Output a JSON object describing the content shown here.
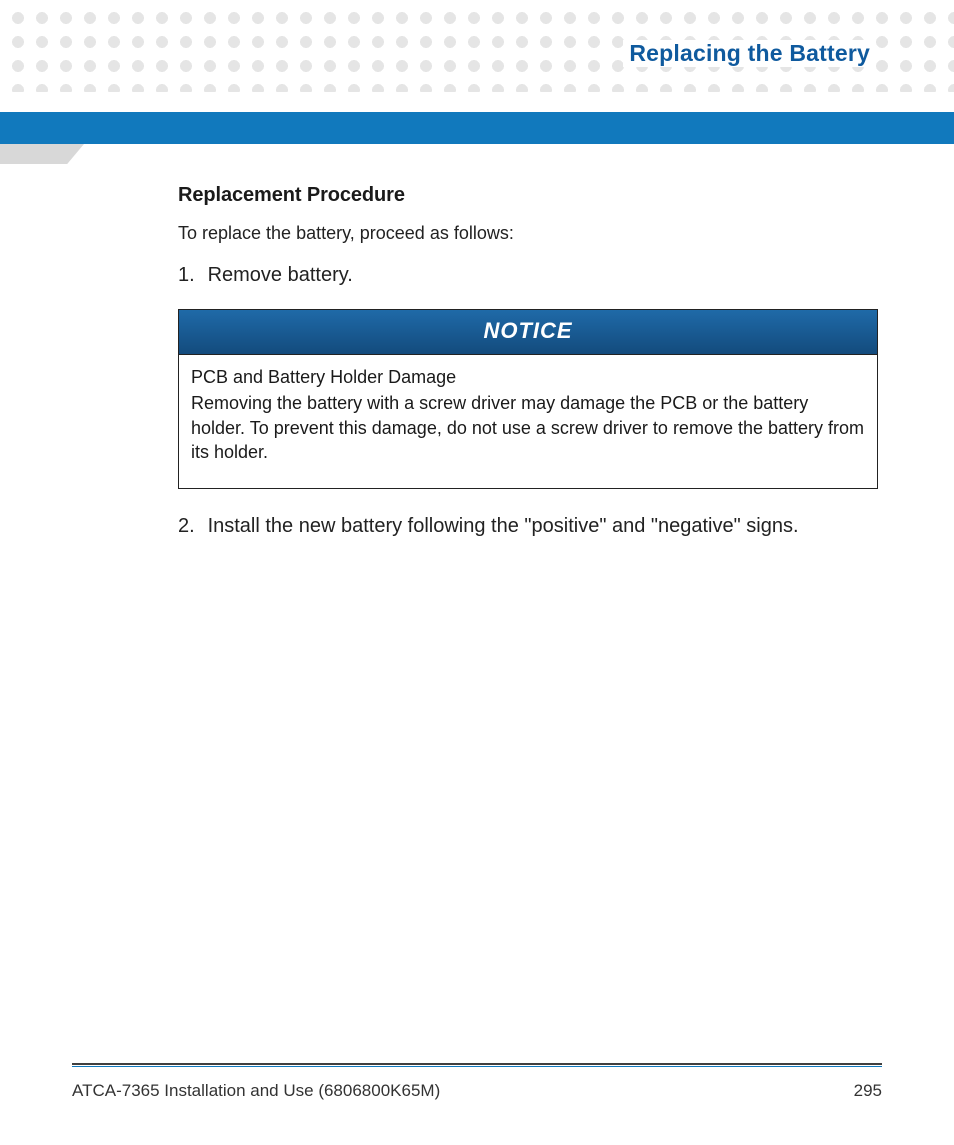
{
  "header": {
    "section_title": "Replacing the Battery"
  },
  "content": {
    "subheading": "Replacement Procedure",
    "intro": "To replace the battery, proceed as follows:",
    "steps": [
      {
        "num": "1.",
        "text": "Remove battery."
      },
      {
        "num": "2.",
        "text": "Install the new battery following the \"positive\" and \"negative\" signs."
      }
    ],
    "notice": {
      "label": "NOTICE",
      "title": "PCB and Battery Holder Damage",
      "body": "Removing the battery with a screw driver may damage the PCB or the battery holder. To prevent this damage, do not use a screw driver to remove the battery from its holder."
    }
  },
  "footer": {
    "doc": "ATCA-7365 Installation and Use (6806800K65M)",
    "page": "295"
  }
}
